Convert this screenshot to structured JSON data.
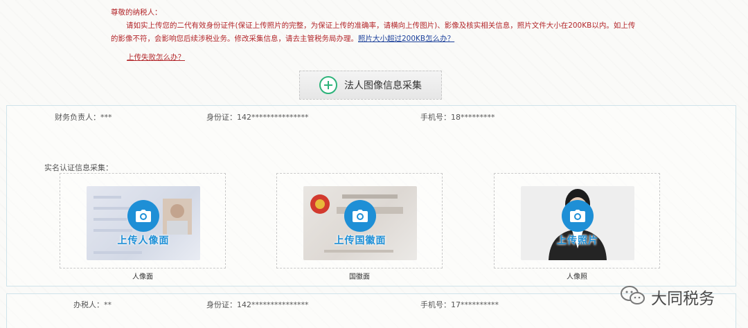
{
  "notice": {
    "greeting": "尊敬的纳税人：",
    "body": "请如实上传您的二代有效身份证件(保证上传照片的完整，为保证上传的准确率，请横向上传图片)、影像及核实相关信息，照片文件大小在200KB以内。如上传的影像不符，会影响您后续涉税业务。修改采集信息，请去主管税务局办理。",
    "size_link": "照片大小超过200KB怎么办？",
    "fail_link": "上传失败怎么办？"
  },
  "collect_button": {
    "label": "法人图像信息采集",
    "icon": "plus-circle-icon"
  },
  "finance": {
    "name_label": "财务负责人：",
    "name_value": "***",
    "id_label": "身份证：",
    "id_value": "142***************",
    "phone_label": "手机号：",
    "phone_value": "18*********"
  },
  "realname": {
    "section_label": "实名认证信息采集：",
    "uploads": [
      {
        "overlay": "上传人像面",
        "caption": "人像面",
        "icon": "camera-icon"
      },
      {
        "overlay": "上传国徽面",
        "caption": "国徽面",
        "icon": "camera-icon"
      },
      {
        "overlay": "上传照片",
        "caption": "人像照",
        "icon": "camera-icon"
      }
    ]
  },
  "taxer": {
    "name_label": "办税人：",
    "name_value": "**",
    "id_label": "身份证：",
    "id_value": "142***************",
    "phone_label": "手机号：",
    "phone_value": "17**********"
  },
  "watermark": {
    "text": "大同税务",
    "icon": "wechat-icon"
  },
  "colors": {
    "notice_red": "#b3272b",
    "link_blue": "#1a3f9a",
    "accent_blue": "#1e8fd6",
    "plus_green": "#2db37a"
  }
}
